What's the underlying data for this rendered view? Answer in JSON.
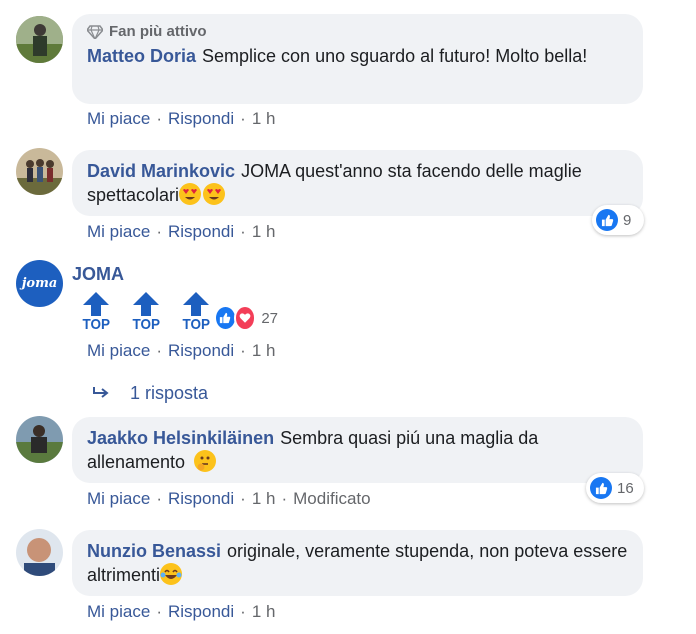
{
  "comments": [
    {
      "badge": "Fan più attivo",
      "author": "Matteo Doria",
      "text": "Semplice con uno sguardo al futuro! Molto bella!",
      "like": "Mi piace",
      "reply": "Rispondi",
      "time": "1 h"
    },
    {
      "author": "David Marinkovic",
      "text": "JOMA quest'anno sta facendo delle maglie spettacolari",
      "like": "Mi piace",
      "reply": "Rispondi",
      "time": "1 h",
      "reaction_count": "9"
    },
    {
      "author": "JOMA",
      "avatar_text": "joma",
      "sticker_label": "TOP",
      "like": "Mi piace",
      "reply": "Rispondi",
      "time": "1 h",
      "reaction_count": "27"
    },
    {
      "author": "Jaakko Helsinkiläinen",
      "text": "Sembra quasi piú una maglia da allenamento",
      "like": "Mi piace",
      "reply": "Rispondi",
      "time": "1 h",
      "edited": "Modificato",
      "reaction_count": "16"
    },
    {
      "author": "Nunzio Benassi",
      "text": "originale, veramente stupenda, non poteva essere altrimenti",
      "like": "Mi piace",
      "reply": "Rispondi",
      "time": "1 h"
    }
  ],
  "replies_link": "1 risposta",
  "colors": {
    "link": "#385898",
    "bubble": "#f0f2f5",
    "like": "#1877f2",
    "love": "#f33e58",
    "joma": "#1d5fbf"
  }
}
